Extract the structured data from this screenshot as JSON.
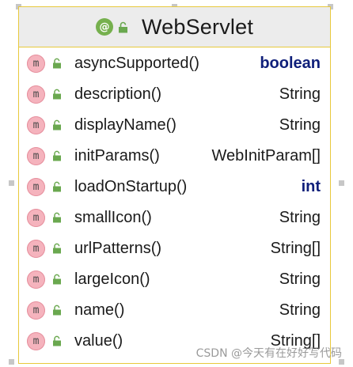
{
  "header": {
    "title": "WebServlet",
    "annotation_icon": "annotation-icon",
    "annotation_symbol": "@",
    "visibility_icon": "lock-icon"
  },
  "colors": {
    "border": "#e8c93c",
    "header_bg": "#ececec",
    "method_icon_bg": "#f5b3bd",
    "lock_green": "#6aa84f",
    "keyword_blue": "#0f1f7a"
  },
  "methods": [
    {
      "icon": "method-icon",
      "symbol": "m",
      "name": "asyncSupported()",
      "type": "boolean",
      "keyword": true
    },
    {
      "icon": "method-icon",
      "symbol": "m",
      "name": "description()",
      "type": "String",
      "keyword": false
    },
    {
      "icon": "method-icon",
      "symbol": "m",
      "name": "displayName()",
      "type": "String",
      "keyword": false
    },
    {
      "icon": "method-icon",
      "symbol": "m",
      "name": "initParams()",
      "type": "WebInitParam[]",
      "keyword": false
    },
    {
      "icon": "method-icon",
      "symbol": "m",
      "name": "loadOnStartup()",
      "type": "int",
      "keyword": true
    },
    {
      "icon": "method-icon",
      "symbol": "m",
      "name": "smallIcon()",
      "type": "String",
      "keyword": false
    },
    {
      "icon": "method-icon",
      "symbol": "m",
      "name": "urlPatterns()",
      "type": "String[]",
      "keyword": false
    },
    {
      "icon": "method-icon",
      "symbol": "m",
      "name": "largeIcon()",
      "type": "String",
      "keyword": false
    },
    {
      "icon": "method-icon",
      "symbol": "m",
      "name": "name()",
      "type": "String",
      "keyword": false
    },
    {
      "icon": "method-icon",
      "symbol": "m",
      "name": "value()",
      "type": "String[]",
      "keyword": false
    }
  ],
  "watermark": "CSDN @今天有在好好写代码"
}
